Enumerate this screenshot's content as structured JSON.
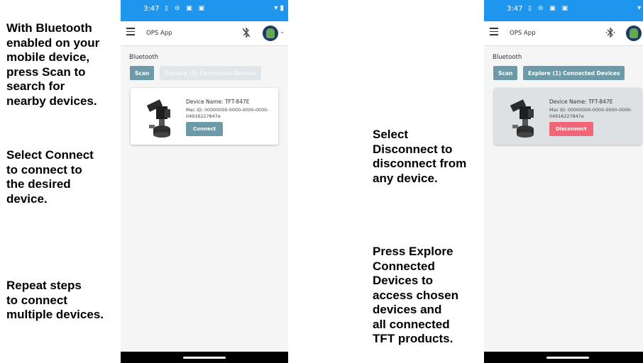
{
  "left_instructions": [
    "With Bluetooth\nenabled on your\nmobile device,\npress Scan to\nsearch for\nnearby devices.",
    "Select Connect\nto connect to\nthe desired\ndevice.",
    "Repeat steps\nto connect\nmultiple devices."
  ],
  "right_instructions": [
    "Select\nDisconnect to\ndisconnect from\nany device.",
    "Press Explore\nConnected\nDevices to\naccess chosen\ndevices and\nall connected\nTFT products."
  ],
  "phones": [
    {
      "status_time": "3:47",
      "app_title": "OPS App",
      "section_title": "Bluetooth",
      "scan_label": "Scan",
      "explore_label": "Explore (0) Connected Devices",
      "device_name": "Device Name: TFT-847E",
      "mac_id": "Mac ID: 00000000-0000-0000-0000-04916227847e",
      "action_label": "Connect",
      "bluetooth_icon": "bluetooth-disabled-icon"
    },
    {
      "status_time": "3:47",
      "app_title": "OPS App",
      "section_title": "Bluetooth",
      "scan_label": "Scan",
      "explore_label": "Explore (1) Connected Devices",
      "device_name": "Device Name: TFT-847E",
      "mac_id": "Mac ID: 00000000-0000-0000-0000-04916227847e",
      "action_label": "Disconnect",
      "bluetooth_icon": "bluetooth-connected-icon"
    }
  ],
  "colors": {
    "status_bar": "#1f96ed",
    "primary_button": "#6d9aa8",
    "disconnect_button": "#ef6677"
  }
}
